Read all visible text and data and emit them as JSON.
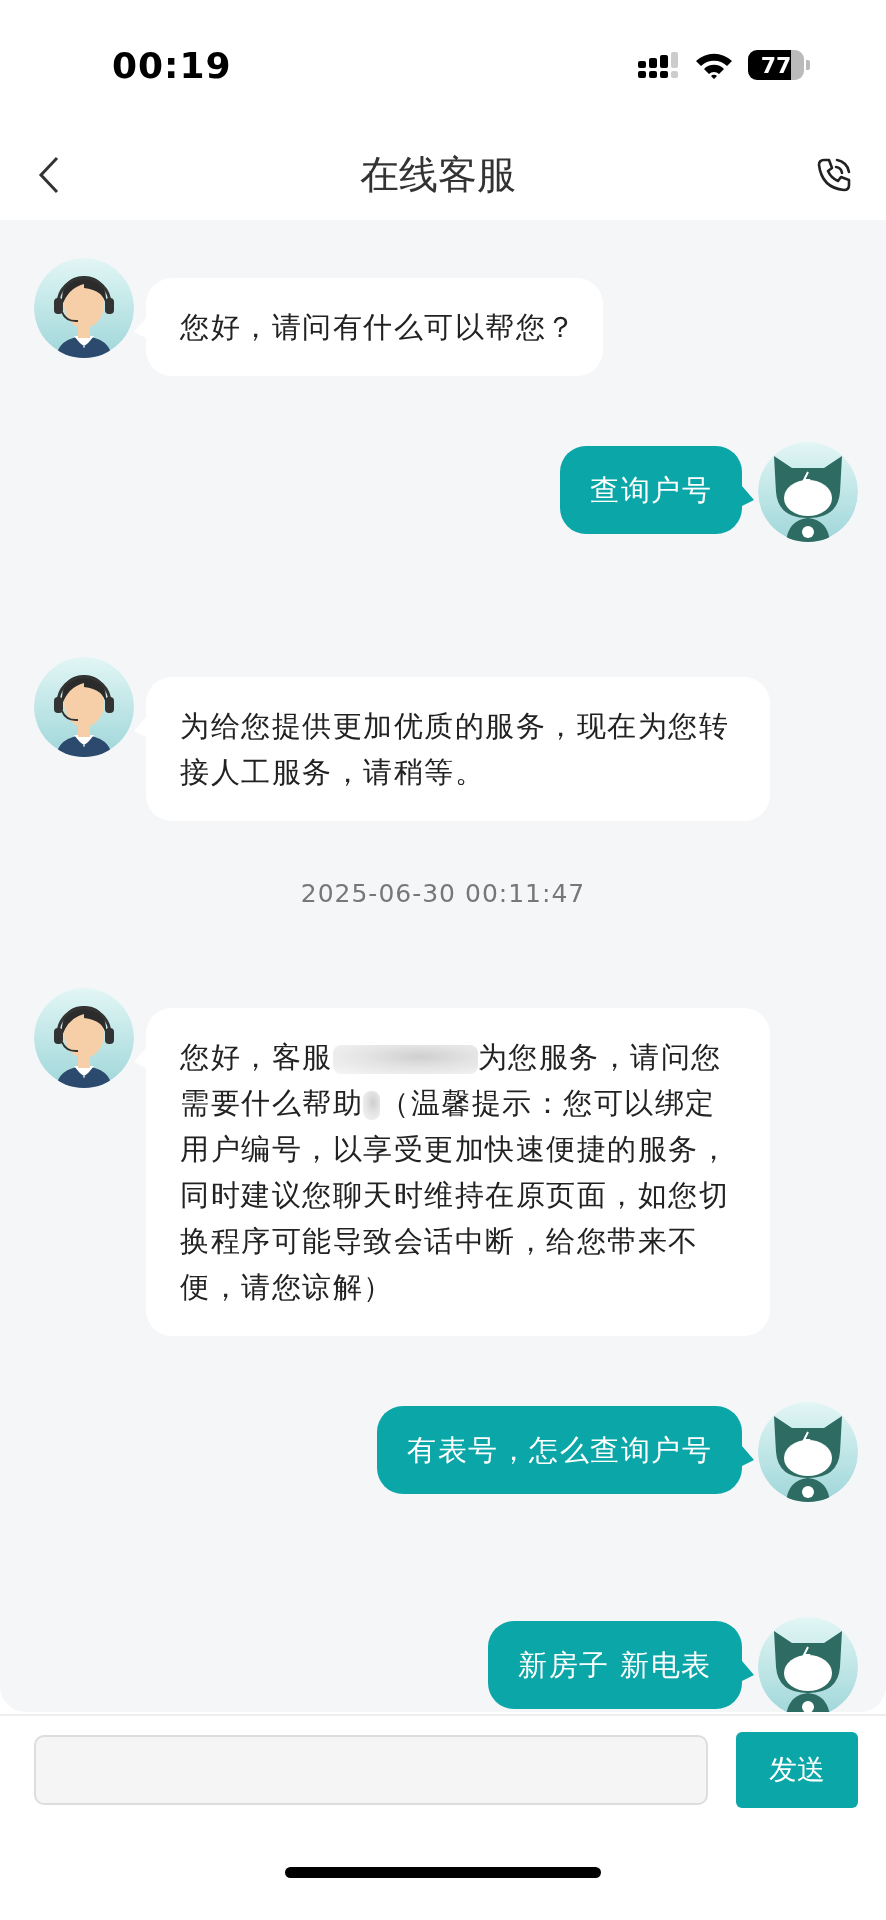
{
  "status_bar": {
    "time": "00:19",
    "battery": "77"
  },
  "nav_bar": {
    "title": "在线客服"
  },
  "messages": [
    {
      "kind": "agent",
      "parts": [
        "您好，请问有什么可以帮您？"
      ]
    },
    {
      "kind": "user",
      "parts": [
        "查询户号"
      ]
    },
    {
      "kind": "agent",
      "parts": [
        "为给您提供更加优质的服务，现在为您转接人工服务，请稍等。"
      ]
    },
    {
      "kind": "timestamp",
      "text": "2025-06-30 00:11:47"
    },
    {
      "kind": "agent",
      "parts": [
        "您好，客服",
        "为您服务，请问您需要什么帮助",
        "（温馨提示：您可以绑定用户编号，以享受更加快速便捷的服务，同时建议您聊天时维持在原页面，如您切换程序可能导致会话中断，给您带来不便，请您谅解）"
      ]
    },
    {
      "kind": "user",
      "parts": [
        "有表号，怎么查询户号"
      ]
    },
    {
      "kind": "user",
      "parts": [
        "新房子 新电表"
      ]
    }
  ],
  "composer": {
    "send_button": "发送"
  }
}
